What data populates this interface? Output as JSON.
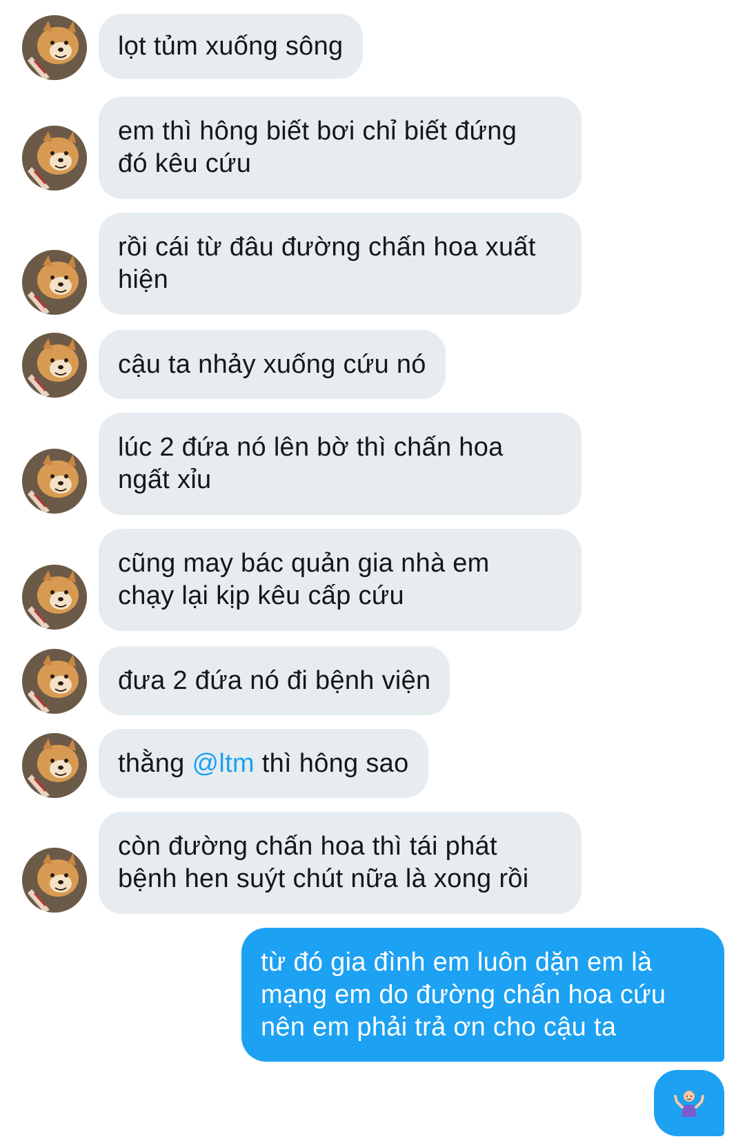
{
  "conversation": {
    "incoming": [
      {
        "text": "lọt tủm xuống sông"
      },
      {
        "text": "em thì hông biết bơi chỉ biết đứng\nđó kêu cứu"
      },
      {
        "text": "rồi cái từ đâu đường chấn hoa xuất\nhiện"
      },
      {
        "text": "cậu ta nhảy xuống cứu nó"
      },
      {
        "text": "lúc 2 đứa nó lên bờ thì chấn hoa\nngất xỉu"
      },
      {
        "text": "cũng may bác quản gia nhà em\nchạy lại kịp kêu cấp cứu"
      },
      {
        "text": "đưa 2 đứa nó đi bệnh viện"
      },
      {
        "text_before": "thằng ",
        "mention": "@ltm",
        "text_after": " thì hông sao"
      },
      {
        "text": "còn đường chấn hoa thì tái phát\nbệnh hen suýt chút nữa là xong rồi"
      }
    ],
    "outgoing": [
      {
        "text": "từ đó gia đình em luôn dặn em là\nmạng em do đường chấn hoa cứu\nnên em phải trả ơn cho cậu ta"
      },
      {
        "emoji": "🤷‍♂️",
        "icon": "man-shrugging-emoji"
      }
    ],
    "avatar": {
      "icon": "shiba-dog-avatar"
    },
    "colors": {
      "incoming_bubble": "#e6ecf0",
      "outgoing_bubble": "#1da1f2",
      "mention": "#1da1f2",
      "text": "#14171a"
    }
  }
}
